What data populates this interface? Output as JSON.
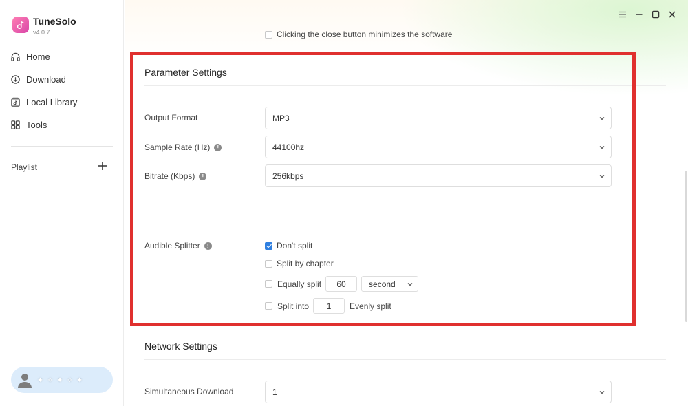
{
  "app": {
    "name": "TuneSolo",
    "version": "v4.0.7"
  },
  "sidebar": {
    "nav": [
      {
        "label": "Home",
        "icon": "headphones-icon"
      },
      {
        "label": "Download",
        "icon": "download-icon"
      },
      {
        "label": "Local Library",
        "icon": "library-icon"
      },
      {
        "label": "Tools",
        "icon": "tools-grid-icon"
      }
    ],
    "playlist_label": "Playlist",
    "user": {
      "name": "✦ ✧ ✦ ✧ ✦"
    }
  },
  "general": {
    "close_option_label": "Clicking the close button minimizes the software",
    "close_option_checked": false
  },
  "parameter_settings": {
    "title": "Parameter Settings",
    "output_format": {
      "label": "Output Format",
      "value": "MP3"
    },
    "sample_rate": {
      "label": "Sample Rate (Hz)",
      "value": "44100hz"
    },
    "bitrate": {
      "label": "Bitrate (Kbps)",
      "value": "256kbps"
    },
    "audible_splitter": {
      "label": "Audible Splitter",
      "dont_split": {
        "label": "Don't split",
        "checked": true
      },
      "split_by_chapter": {
        "label": "Split by chapter",
        "checked": false
      },
      "equally_split": {
        "label": "Equally split",
        "value": "60",
        "unit": "second",
        "checked": false
      },
      "split_into": {
        "label": "Split into",
        "value": "1",
        "suffix": "Evenly split",
        "checked": false
      }
    },
    "info_glyph": "!"
  },
  "network_settings": {
    "title": "Network Settings",
    "simultaneous_download": {
      "label": "Simultaneous Download",
      "value": "1"
    }
  },
  "colors": {
    "accent": "#2f7fe0",
    "highlight_frame": "#e0302e",
    "logo_pink": "#ff7eb3"
  }
}
